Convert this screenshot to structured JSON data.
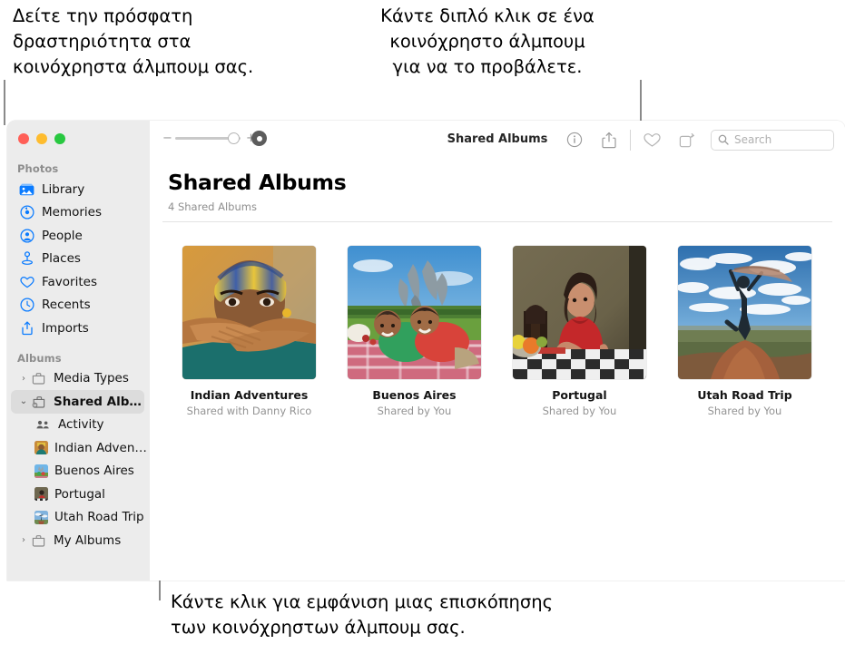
{
  "callouts": {
    "left": "Δείτε την πρόσφατη\nδραστηριότητα στα\nκοινόχρηστα άλμπουμ σας.",
    "right": "Κάντε διπλό κλικ σε ένα\nκοινόχρηστο άλμπουμ\nγια να το προβάλετε.",
    "bottom": "Κάντε κλικ για εμφάνιση μιας επισκόπησης\nτων κοινόχρηστων άλμπουμ σας."
  },
  "window": {
    "traffic_lights": [
      "close",
      "minimize",
      "zoom"
    ]
  },
  "toolbar": {
    "zoom_out_label": "−",
    "zoom_in_label": "+",
    "title": "Shared Albums",
    "info_icon": "info-icon",
    "share_icon": "share-icon",
    "favorite_icon": "heart-icon",
    "rotate_icon": "rotate-icon",
    "search_placeholder": "Search",
    "search_value": ""
  },
  "sidebar": {
    "sections": [
      {
        "header": "Photos",
        "items": [
          {
            "label": "Library",
            "icon": "library-icon"
          },
          {
            "label": "Memories",
            "icon": "memories-icon"
          },
          {
            "label": "People",
            "icon": "people-icon"
          },
          {
            "label": "Places",
            "icon": "places-icon"
          },
          {
            "label": "Favorites",
            "icon": "heart-icon"
          },
          {
            "label": "Recents",
            "icon": "clock-icon"
          },
          {
            "label": "Imports",
            "icon": "import-icon"
          }
        ]
      },
      {
        "header": "Albums",
        "items": [
          {
            "label": "Media Types",
            "icon": "folder-icon",
            "disclosure": "›"
          },
          {
            "label": "Shared Albums",
            "icon": "shared-folder-icon",
            "disclosure": "⌄",
            "selected": true
          },
          {
            "label": "Activity",
            "icon": "activity-icon",
            "indent": true
          },
          {
            "label": "Indian Advent…",
            "icon": "album-thumb-indian",
            "indent": true
          },
          {
            "label": "Buenos Aires",
            "icon": "album-thumb-buenos",
            "indent": true
          },
          {
            "label": "Portugal",
            "icon": "album-thumb-portugal",
            "indent": true
          },
          {
            "label": "Utah Road Trip",
            "icon": "album-thumb-utah",
            "indent": true
          },
          {
            "label": "My Albums",
            "icon": "folder-icon",
            "disclosure": "›"
          }
        ]
      }
    ]
  },
  "main": {
    "title": "Shared Albums",
    "subtitle": "4 Shared Albums",
    "albums": [
      {
        "name": "Indian Adventures",
        "meta": "Shared with Danny Rico"
      },
      {
        "name": "Buenos Aires",
        "meta": "Shared by You"
      },
      {
        "name": "Portugal",
        "meta": "Shared by You"
      },
      {
        "name": "Utah Road Trip",
        "meta": "Shared by You"
      }
    ]
  },
  "colors": {
    "accent": "#0a7bff",
    "sidebar_bg": "#ececec",
    "selected_row": "#dcdcdc",
    "leader_line": "#8a8a8a"
  }
}
